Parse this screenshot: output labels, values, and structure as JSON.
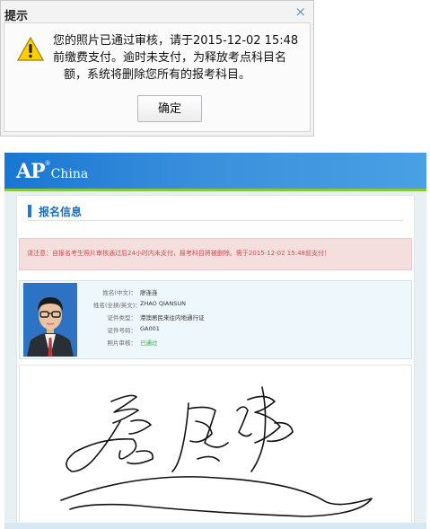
{
  "dialog": {
    "title": "提示",
    "close_symbol": "×",
    "message_line1": "您的照片已通过审核，请于2015-12-02 15:48",
    "message_line2": "前缴费支付。逾时未支付，为释放考点科目名",
    "message_line3": "额，系统将删除您所有的报考科目。",
    "ok_label": "确定",
    "icon": "warning-icon"
  },
  "page": {
    "logo_ap": "AP",
    "logo_reg": "®",
    "logo_china": "China",
    "section_title": "报名信息",
    "notice": "请注意：自报名考生照片审核通过后24小时内未支付，报考科目将被删除。需于2015-12-02 15:48前支付！",
    "profile": {
      "fields": [
        {
          "label": "姓名(中文)：",
          "value": "廖连连"
        },
        {
          "label": "姓名(全拼/英文)：",
          "value": "ZHAO QIANSUN"
        },
        {
          "label": "证件类型：",
          "value": "港澳居民来往内地通行证"
        },
        {
          "label": "证件号码：",
          "value": "GA001"
        },
        {
          "label": "照片审核：",
          "value": "已通过"
        }
      ]
    }
  },
  "colors": {
    "header_blue": "#1976d2",
    "accent_green": "#8cc63f",
    "notice_red": "#d44a4a",
    "approved_green": "#3aa845"
  }
}
